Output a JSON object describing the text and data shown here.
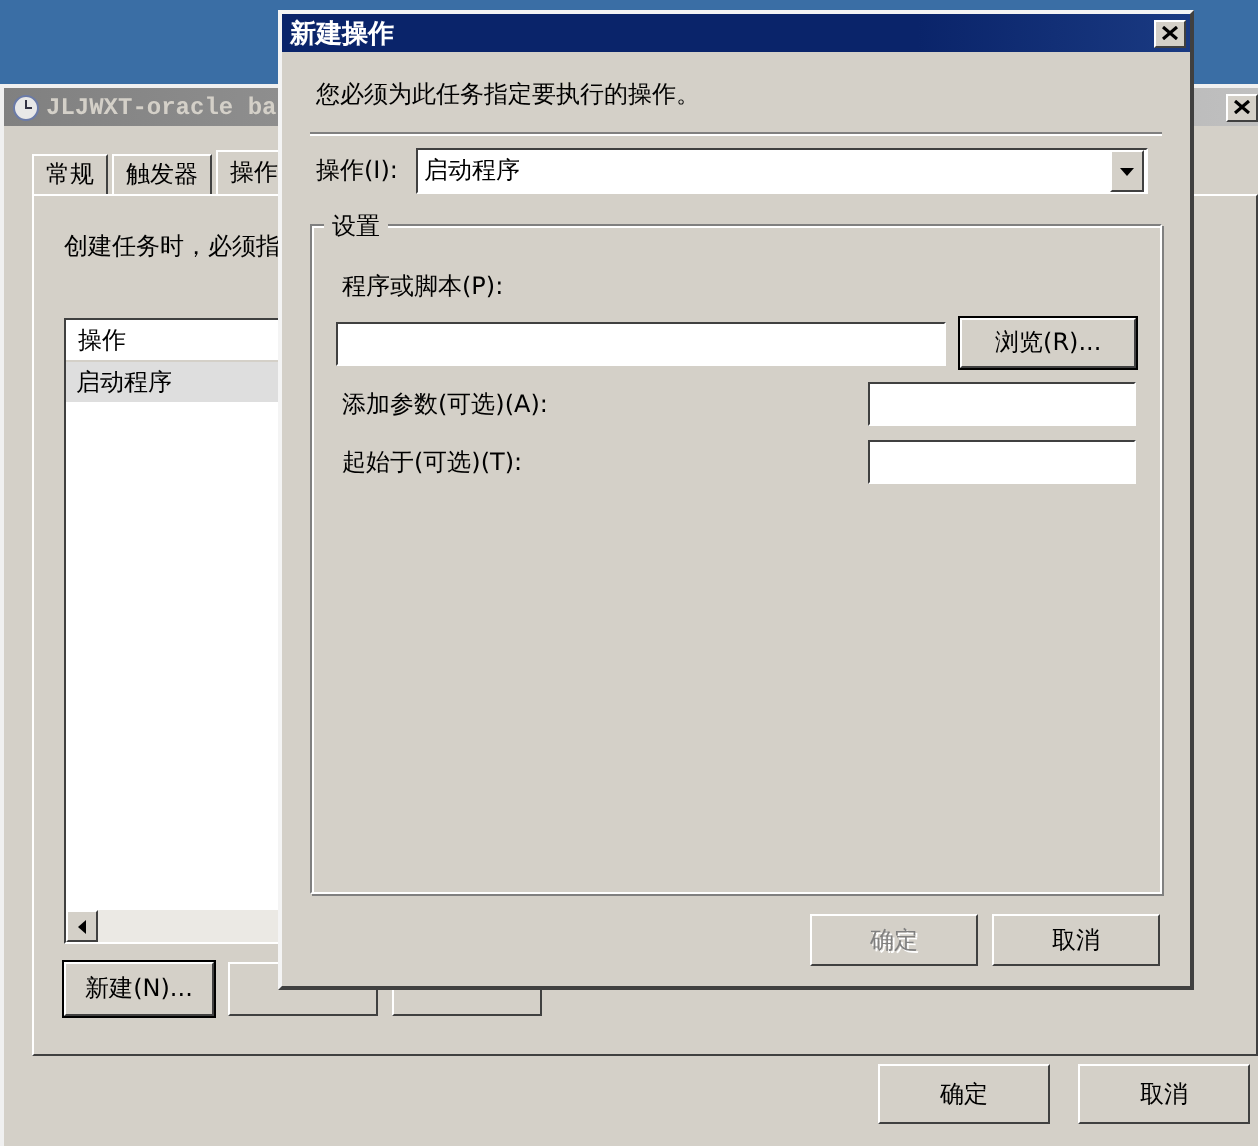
{
  "background_window": {
    "title": "JLJWXT-oracle ba",
    "tabs": [
      {
        "label": "常规",
        "selected": false
      },
      {
        "label": "触发器",
        "selected": false
      },
      {
        "label": "操作",
        "selected": true
      }
    ],
    "description": "创建任务时，必须指",
    "actions_list": {
      "columns": [
        "操作"
      ],
      "rows": [
        {
          "cells": [
            "启动程序"
          ],
          "selected": true
        }
      ]
    },
    "buttons": [
      {
        "label": "新建(N)...",
        "default": true
      },
      {
        "default": false
      },
      {
        "default": false
      }
    ],
    "footer_buttons": [
      {
        "label": "确定"
      },
      {
        "label": "取消"
      }
    ]
  },
  "dialog": {
    "title": "新建操作",
    "instruction": "您必须为此任务指定要执行的操作。",
    "action_label": "操作(I):",
    "action_value": "启动程序",
    "group_title": "设置",
    "program_label": "程序或脚本(P):",
    "browse_button": "浏览(R)...",
    "fields": [
      {
        "label": "添加参数(可选)(A):"
      },
      {
        "label": "起始于(可选)(T):"
      }
    ],
    "buttons": [
      {
        "label": "确定",
        "disabled": true
      },
      {
        "label": "取消",
        "disabled": false
      }
    ]
  }
}
